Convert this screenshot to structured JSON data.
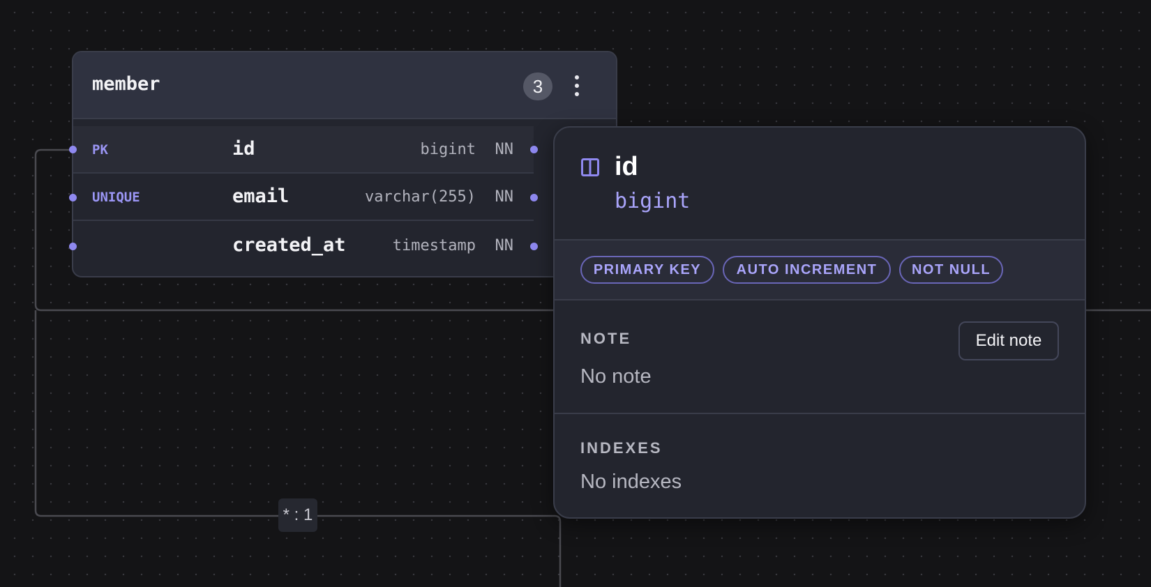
{
  "table": {
    "name": "member",
    "column_count": "3",
    "fields": [
      {
        "badge": "PK",
        "name": "id",
        "type": "bigint",
        "nullability": "NN"
      },
      {
        "badge": "UNIQUE",
        "name": "email",
        "type": "varchar(255)",
        "nullability": "NN"
      },
      {
        "badge": "",
        "name": "created_at",
        "type": "timestamp",
        "nullability": "NN"
      }
    ]
  },
  "relationship": {
    "cardinality": "* : 1"
  },
  "column_detail": {
    "title": "id",
    "type": "bigint",
    "badges": [
      "PRIMARY KEY",
      "AUTO INCREMENT",
      "NOT NULL"
    ],
    "note_label": "NOTE",
    "note_value": "No note",
    "edit_note_label": "Edit note",
    "indexes_label": "INDEXES",
    "indexes_value": "No indexes"
  },
  "colors": {
    "accent": "#8f89f0",
    "canvas_background": "#141416",
    "card_background": "#23252e",
    "edge_line": "#4a4a50"
  },
  "icons": {
    "column": "columns-icon",
    "menu": "more-vertical-icon"
  }
}
